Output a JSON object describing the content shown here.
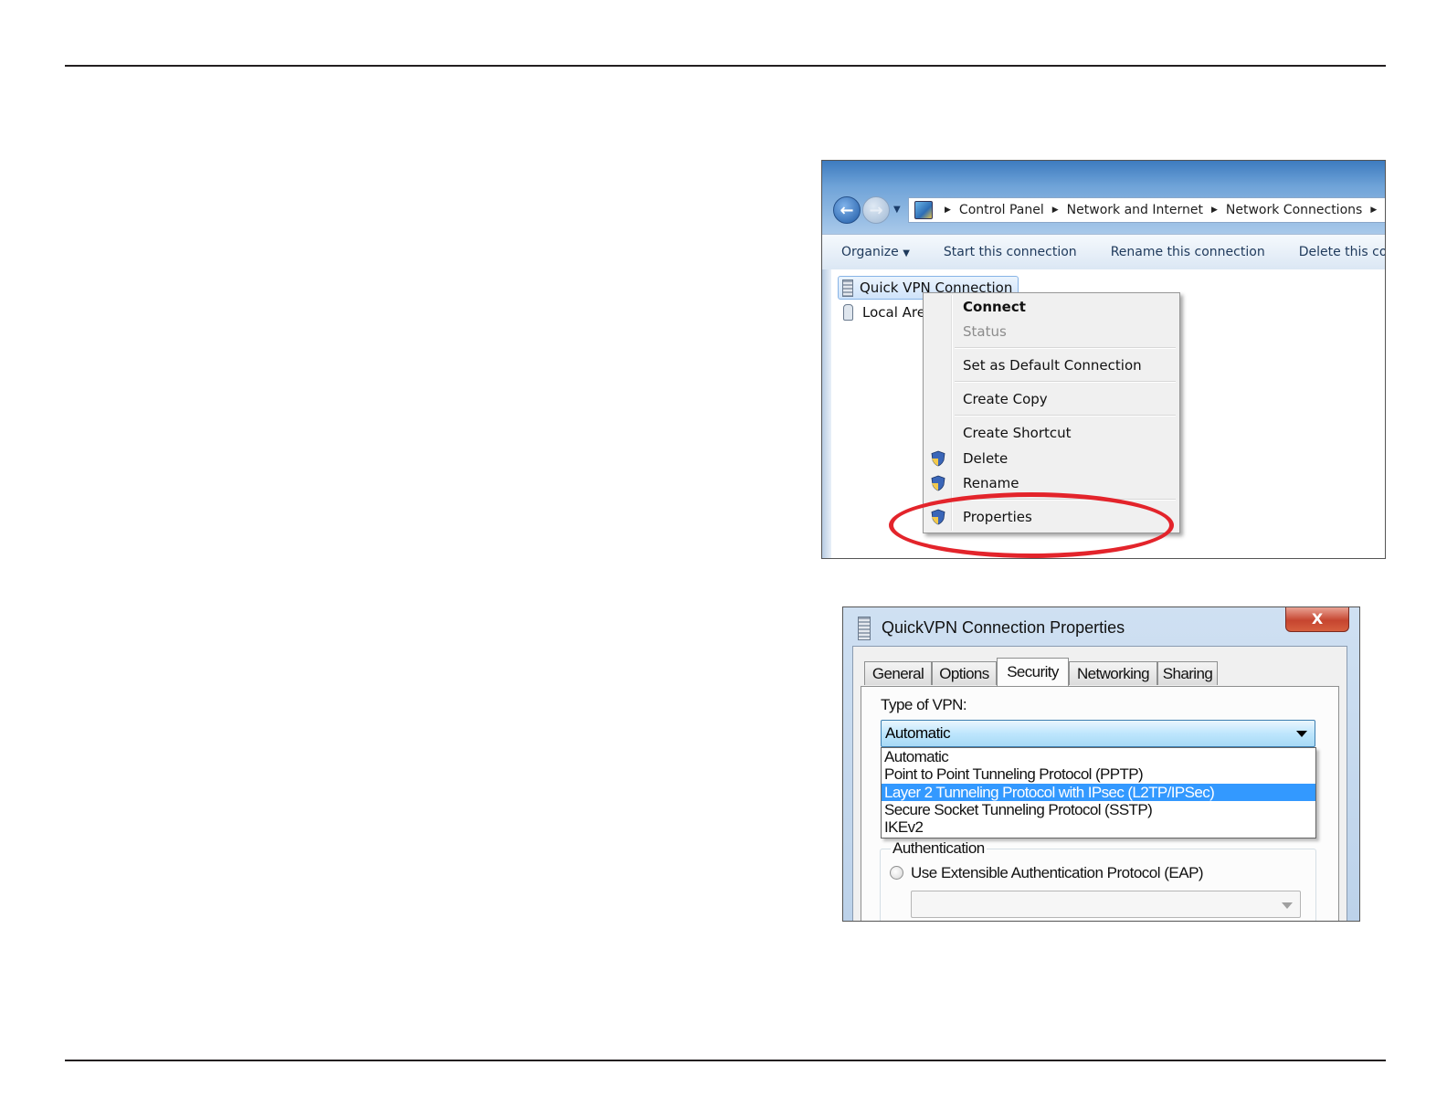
{
  "explorer": {
    "breadcrumb": [
      "Control Panel",
      "Network and Internet",
      "Network Connections"
    ],
    "toolbar": [
      "Organize",
      "Start this connection",
      "Rename this connection",
      "Delete this con"
    ],
    "connections": {
      "vpn": "Quick VPN Connection",
      "lan": "Local Are"
    },
    "context_menu": {
      "connect": "Connect",
      "status": "Status",
      "set_default": "Set as Default Connection",
      "create_copy": "Create Copy",
      "create_shortcut": "Create Shortcut",
      "delete": "Delete",
      "rename": "Rename",
      "properties": "Properties"
    },
    "highlight_color": "#e3242b"
  },
  "dialog": {
    "title": "QuickVPN Connection Properties",
    "close_glyph": "X",
    "tabs": [
      "General",
      "Options",
      "Security",
      "Networking",
      "Sharing"
    ],
    "active_tab": "Security",
    "type_of_vpn_label": "Type of VPN:",
    "type_of_vpn_value": "Automatic",
    "options": [
      "Automatic",
      "Point to Point Tunneling Protocol (PPTP)",
      "Layer 2 Tunneling Protocol with IPsec (L2TP/IPSec)",
      "Secure Socket Tunneling Protocol (SSTP)",
      "IKEv2"
    ],
    "selected_option": "Layer 2 Tunneling Protocol with IPsec (L2TP/IPSec)",
    "authentication_label": "Authentication",
    "eap_radio_label": "Use Extensible Authentication Protocol (EAP)",
    "eap_value": ""
  }
}
